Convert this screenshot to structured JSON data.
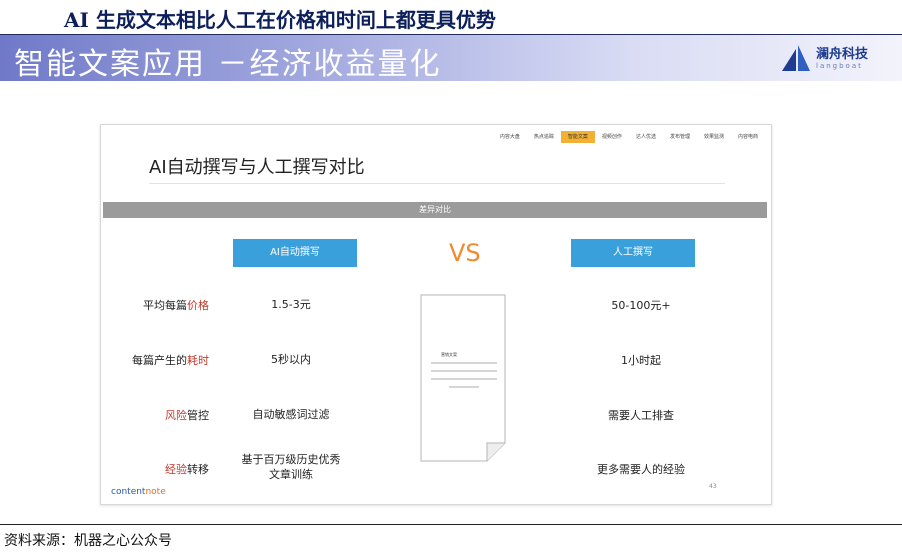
{
  "page_title": "AI 生成文本相比人工在价格和时间上都更具优势",
  "banner": {
    "title": "智能文案应用 －经济收益量化",
    "logo_text": "澜舟科技",
    "logo_sub": "langboat"
  },
  "slide": {
    "nav_tabs": [
      {
        "label": "内容大盘",
        "active": false
      },
      {
        "label": "热点追踪",
        "active": false
      },
      {
        "label": "智能文案",
        "active": true
      },
      {
        "label": "视频创作",
        "active": false
      },
      {
        "label": "达人优选",
        "active": false
      },
      {
        "label": "发布管理",
        "active": false
      },
      {
        "label": "效果监测",
        "active": false
      },
      {
        "label": "内容电商",
        "active": false
      }
    ],
    "title": "AI自动撰写与人工撰写对比",
    "section_label": "差异对比",
    "ai_header": "AI自动撰写",
    "vs_label": "VS",
    "human_header": "人工撰写",
    "rows": [
      {
        "label_pre": "平均每篇",
        "label_hl": "价格",
        "label_post": "",
        "ai": "1.5-3元",
        "human": "50-100元+"
      },
      {
        "label_pre": "每篇产生的",
        "label_hl": "耗时",
        "label_post": "",
        "ai": "5秒以内",
        "human": "1小时起"
      },
      {
        "label_pre": "",
        "label_hl": "风险",
        "label_post": "管控",
        "ai": "自动敏感词过滤",
        "human": "需要人工排查"
      },
      {
        "label_pre": "",
        "label_hl": "经验",
        "label_post": "转移",
        "ai": "基于百万级历史优秀文章训练",
        "human": "更多需要人的经验"
      }
    ],
    "doc_caption": "营销文案",
    "brand_pre": "content",
    "brand_post": "note",
    "page_number": "43"
  },
  "source": "资料来源：机器之心公众号",
  "colors": {
    "accent_blue": "#3aa0dc",
    "vs_orange": "#f28a2d",
    "highlight_red": "#c0392b",
    "active_tab": "#f2b133"
  }
}
